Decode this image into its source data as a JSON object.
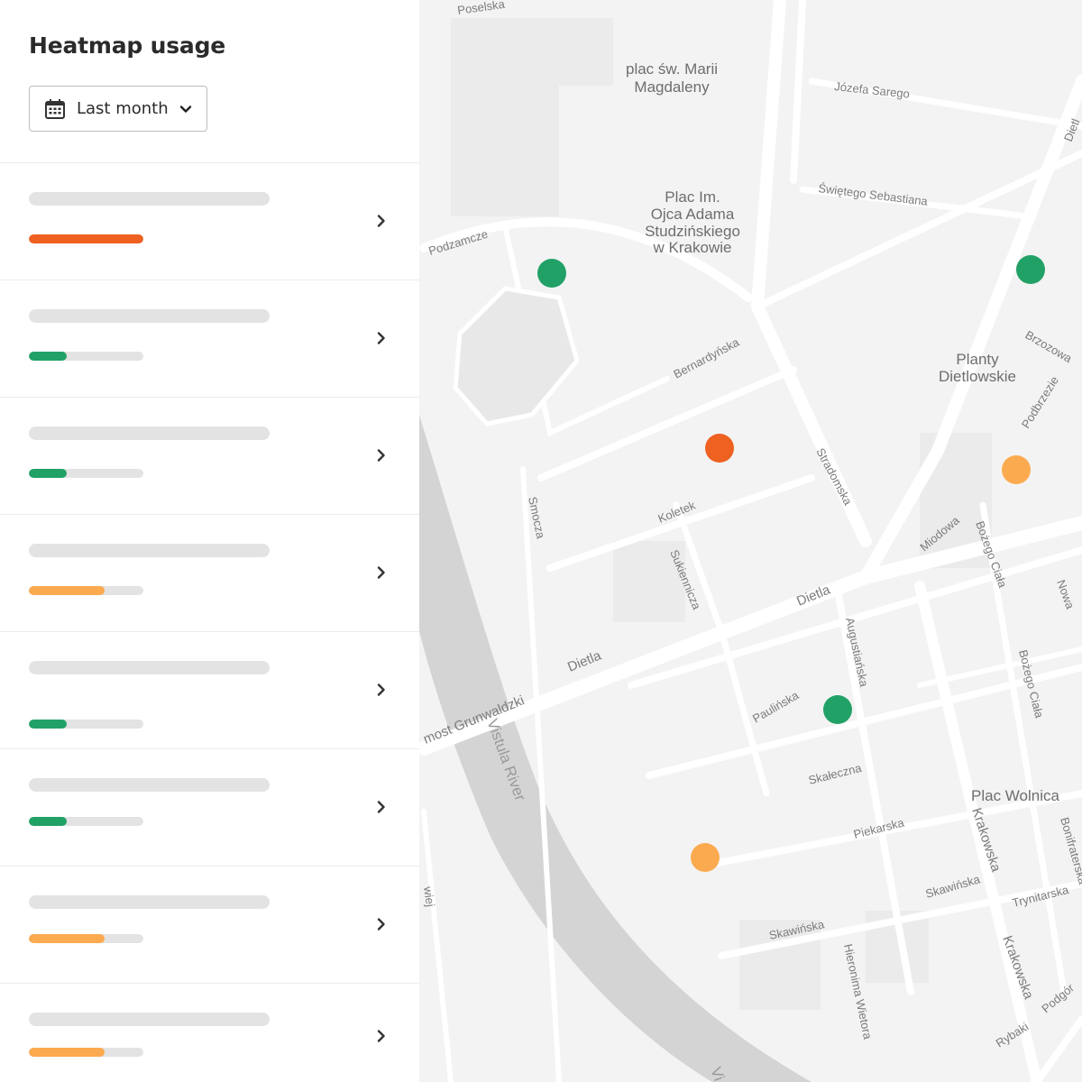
{
  "sidebar": {
    "title": "Heatmap usage",
    "date_filter": {
      "label": "Last month",
      "icon": "calendar-icon",
      "dropdown_icon": "chevron-down-icon"
    },
    "rows": [
      {
        "level": 1.0,
        "color": "#ee6120"
      },
      {
        "level": 0.33,
        "color": "#22a167"
      },
      {
        "level": 0.33,
        "color": "#22a167"
      },
      {
        "level": 0.66,
        "color": "#fcaa50"
      },
      {
        "level": 0.33,
        "color": "#22a167"
      },
      {
        "level": 0.33,
        "color": "#22a167"
      },
      {
        "level": 0.66,
        "color": "#fcaa50"
      },
      {
        "level": 0.66,
        "color": "#fcaa50"
      }
    ]
  },
  "map": {
    "places": {
      "plac_marii_1": "plac św. Marii",
      "plac_marii_2": "Magdaleny",
      "plac_ojca_1": "Plac Im.",
      "plac_ojca_2": "Ojca Adama",
      "plac_ojca_3": "Studzińskiego",
      "plac_ojca_4": "w Krakowie",
      "planty_1": "Planty",
      "planty_2": "Dietlowskie",
      "plac_wolnica": "Plac Wolnica"
    },
    "streets": {
      "poselska": "Poselska",
      "jozefa_sarego": "Józefa Sarego",
      "dietl_top": "Dietl",
      "swietego_sebastiana": "Świętego Sebastiana",
      "podzamcze": "Podzamcze",
      "brzozowa": "Brzozowa",
      "bernardynska": "Bernardyńska",
      "podbrzezie": "Podbrzezie",
      "stradomska": "Stradomska",
      "smocza": "Smocza",
      "koletek": "Koletek",
      "miodowa": "Miodowa",
      "bozego_ciala_1": "Bożego Ciała",
      "sukiennicza": "Sukiennicza",
      "nowa": "Nowa",
      "dietla_1": "Dietla",
      "dietla_2": "Dietla",
      "augustianska": "Augustiańska",
      "bozego_ciala_2": "Bożego Ciała",
      "most_grunwaldzki": "most Grunwaldzki",
      "paulinska": "Paulińska",
      "skaleczna": "Skałeczna",
      "piekarska": "Piekarska",
      "krakowska_1": "Krakowska",
      "bonifraterska": "Bonifraterska",
      "skawinska_1": "Skawińska",
      "trynitarska": "Trynitarska",
      "skawinska_2": "Skawińska",
      "hieronima_wietora": "Hieronima Wietora",
      "krakowska_2": "Krakowska",
      "rybaki": "Rybaki",
      "podgorze": "Podgór",
      "wiej": "wiej"
    },
    "river": "Vistula River",
    "river_bottom": "Vi",
    "markers": [
      {
        "color": "#22a167"
      },
      {
        "color": "#22a167"
      },
      {
        "color": "#ee6120"
      },
      {
        "color": "#fcaa50"
      },
      {
        "color": "#22a167"
      },
      {
        "color": "#fcaa50"
      }
    ]
  }
}
